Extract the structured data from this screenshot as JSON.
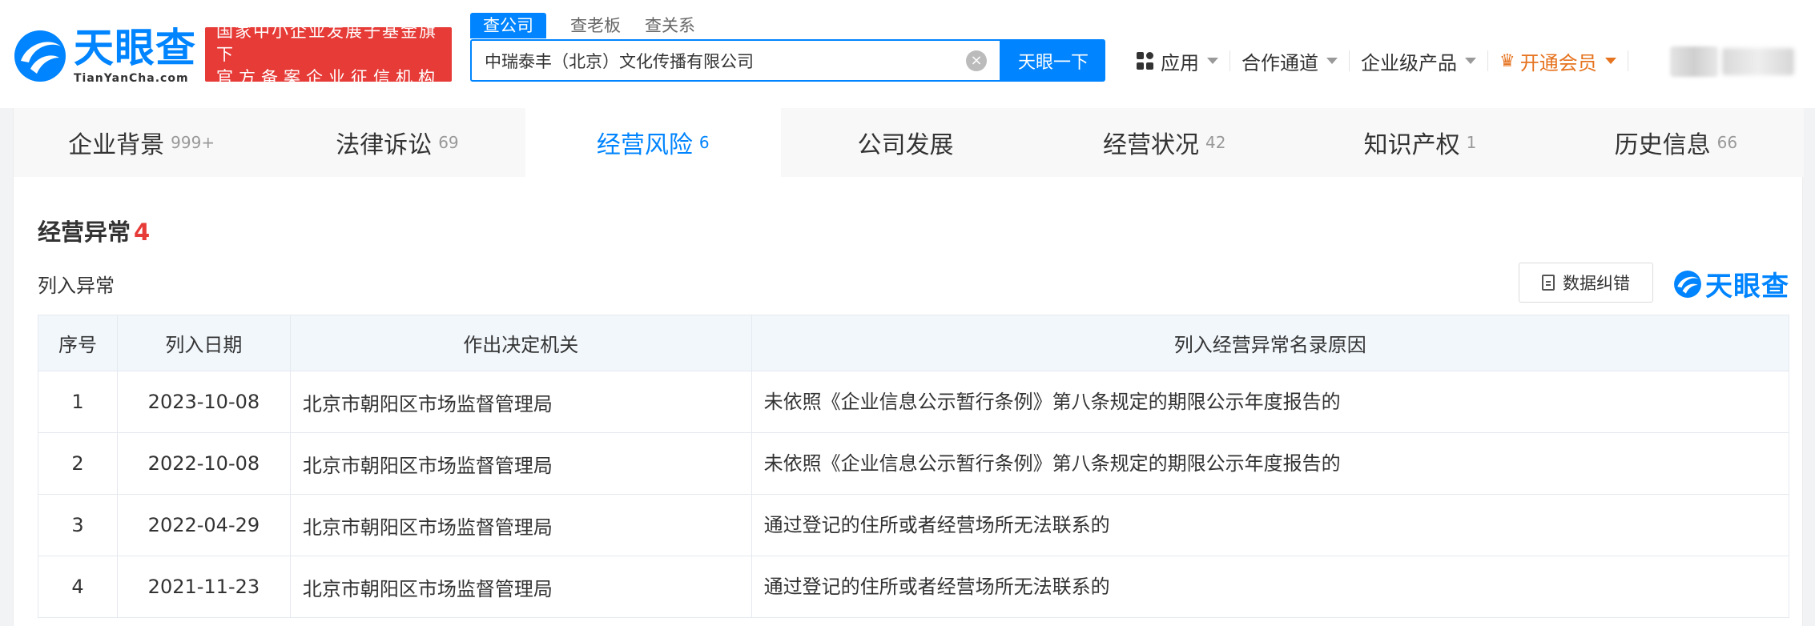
{
  "brand": {
    "name_cn": "天眼查",
    "name_en": "TianYanCha.com",
    "badge_line1": "国家中小企业发展子基金旗下",
    "badge_line2": "官方备案企业征信机构",
    "primary_color": "#0084ff",
    "badge_color": "#e63b37"
  },
  "search": {
    "tabs": [
      "查公司",
      "查老板",
      "查关系"
    ],
    "active_tab": 0,
    "value": "中瑞泰丰（北京）文化传播有限公司",
    "button_label": "天眼一下"
  },
  "topnav": {
    "apps_label": "应用",
    "partner_label": "合作通道",
    "enterprise_label": "企业级产品",
    "vip_label": "开通会员"
  },
  "tabs": [
    {
      "label": "企业背景",
      "count": "999+"
    },
    {
      "label": "法律诉讼",
      "count": "69"
    },
    {
      "label": "经营风险",
      "count": "6"
    },
    {
      "label": "公司发展",
      "count": ""
    },
    {
      "label": "经营状况",
      "count": "42"
    },
    {
      "label": "知识产权",
      "count": "1"
    },
    {
      "label": "历史信息",
      "count": "66"
    }
  ],
  "active_tab_index": 2,
  "section": {
    "title": "经营异常",
    "count": "4",
    "subtitle": "列入异常",
    "correct_button": "数据纠错",
    "watermark": "天眼查"
  },
  "table": {
    "headers": [
      "序号",
      "列入日期",
      "作出决定机关",
      "列入经营异常名录原因"
    ],
    "rows": [
      [
        "1",
        "2023-10-08",
        "北京市朝阳区市场监督管理局",
        "未依照《企业信息公示暂行条例》第八条规定的期限公示年度报告的"
      ],
      [
        "2",
        "2022-10-08",
        "北京市朝阳区市场监督管理局",
        "未依照《企业信息公示暂行条例》第八条规定的期限公示年度报告的"
      ],
      [
        "3",
        "2022-04-29",
        "北京市朝阳区市场监督管理局",
        "通过登记的住所或者经营场所无法联系的"
      ],
      [
        "4",
        "2021-11-23",
        "北京市朝阳区市场监督管理局",
        "通过登记的住所或者经营场所无法联系的"
      ]
    ]
  }
}
